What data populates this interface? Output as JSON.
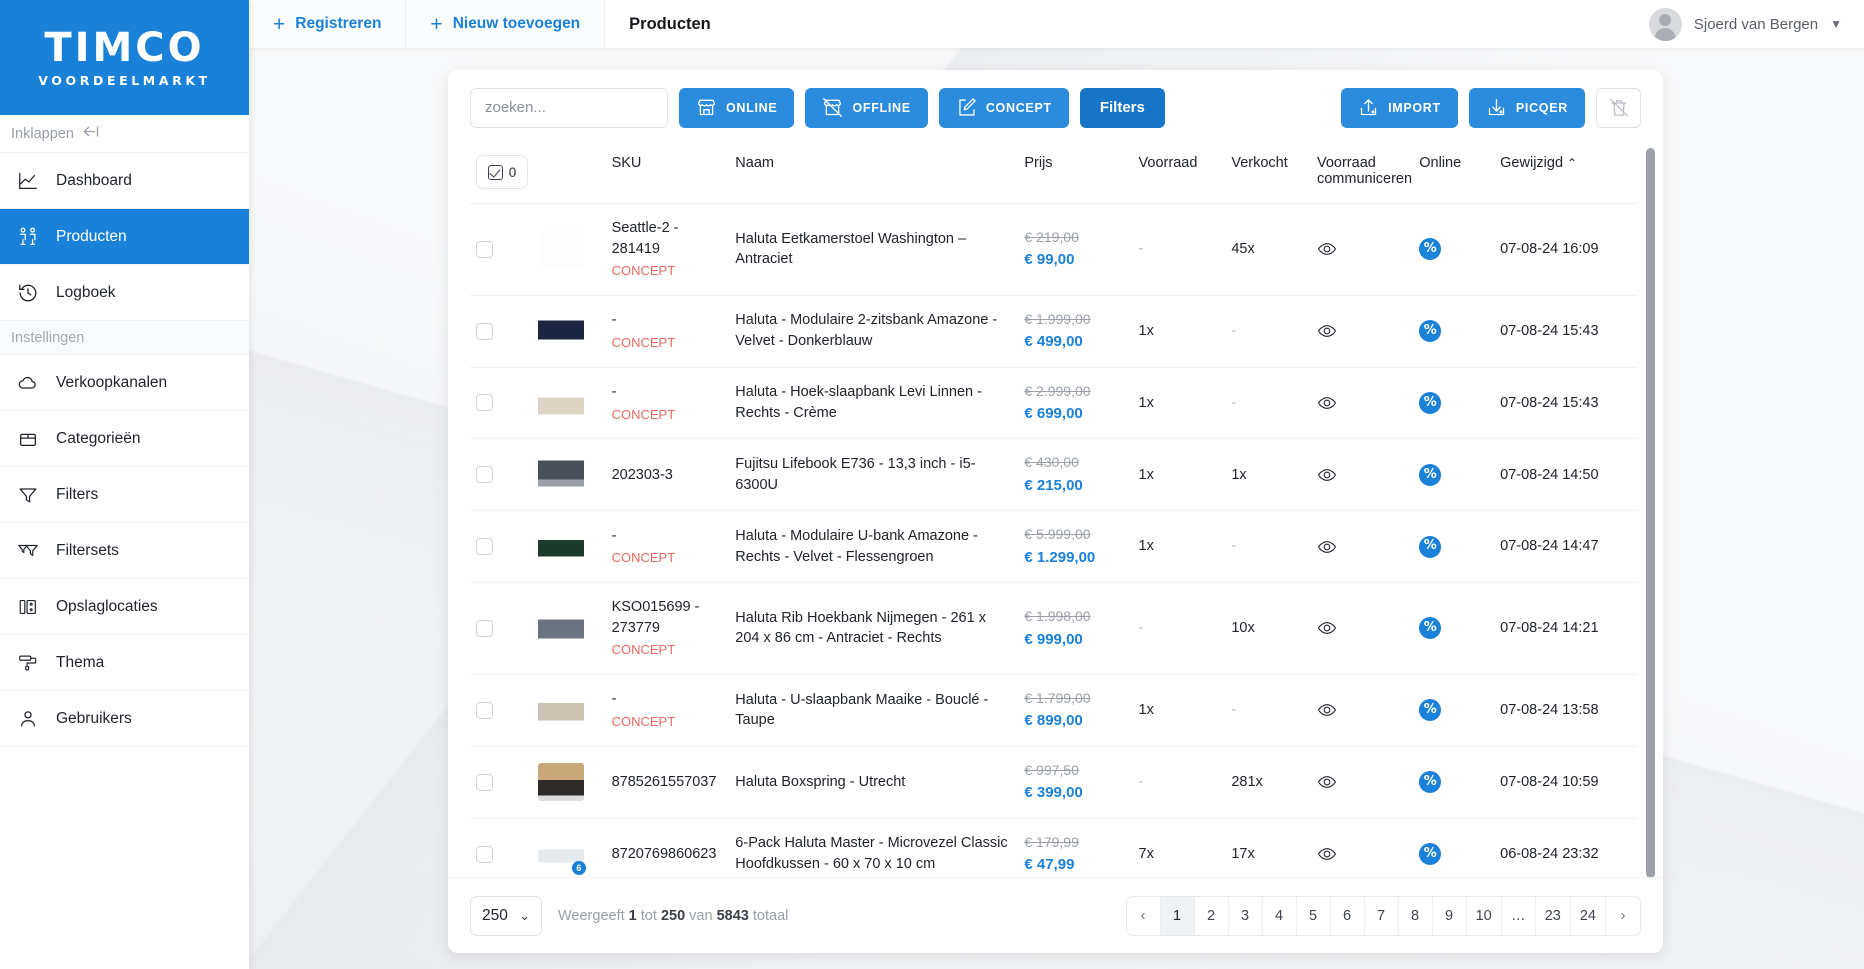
{
  "brand": {
    "name": "TIMCO",
    "tagline": "VOORDEELMARKT",
    "accent": "#1a81d8"
  },
  "sidebar": {
    "collapse_label": "Inklappen",
    "collapse_icon": "collapse-arrow-icon",
    "section_label": "Instellingen",
    "items": [
      {
        "label": "Dashboard",
        "icon": "chart-line-icon",
        "active": false
      },
      {
        "label": "Producten",
        "icon": "products-icon",
        "active": true
      },
      {
        "label": "Logboek",
        "icon": "history-clock-icon",
        "active": false
      }
    ],
    "settings_items": [
      {
        "label": "Verkoopkanalen",
        "icon": "cloud-icon"
      },
      {
        "label": "Categorieën",
        "icon": "box-icon"
      },
      {
        "label": "Filters",
        "icon": "funnel-icon"
      },
      {
        "label": "Filtersets",
        "icon": "double-funnel-icon"
      },
      {
        "label": "Opslaglocaties",
        "icon": "warehouse-icon"
      },
      {
        "label": "Thema",
        "icon": "paint-roller-icon"
      },
      {
        "label": "Gebruikers",
        "icon": "user-icon"
      }
    ]
  },
  "topbar": {
    "register_label": "Registreren",
    "new_label": "Nieuw toevoegen",
    "page_title": "Producten",
    "user_name": "Sjoerd van Bergen"
  },
  "toolbar": {
    "search_placeholder": "zoeken...",
    "search_value": "",
    "online_label": "ONLINE",
    "offline_label": "OFFLINE",
    "concept_label": "CONCEPT",
    "filters_label": "Filters",
    "import_label": "IMPORT",
    "picqer_label": "PICQER",
    "delete_icon": "trash-disabled-icon"
  },
  "table": {
    "selected_count": "0",
    "headers": {
      "sku": "SKU",
      "naam": "Naam",
      "prijs": "Prijs",
      "voorraad": "Voorraad",
      "verkocht": "Verkocht",
      "voorraad_communiceren": "Voorraad communiceren",
      "online": "Online",
      "gewijzigd": "Gewijzigd",
      "sort_caret": "⌃"
    },
    "rows": [
      {
        "sku": "Seattle-2 - 281419",
        "concept": "CONCEPT",
        "naam": "Haluta Eetkamerstoel Washington – Antraciet",
        "prijs_oud": "€ 219,00",
        "prijs_nieuw": "€ 99,00",
        "voorraad": "-",
        "verkocht": "45x",
        "gewijzigd": "07-08-24 16:09",
        "thumb": "chair",
        "badge": ""
      },
      {
        "sku": "-",
        "concept": "CONCEPT",
        "naam": "Haluta - Modulaire 2-zitsbank Amazone - Velvet - Donkerblauw",
        "prijs_oud": "€ 1.999,00",
        "prijs_nieuw": "€ 499,00",
        "voorraad": "1x",
        "verkocht": "-",
        "gewijzigd": "07-08-24 15:43",
        "thumb": "sofa-navy",
        "badge": ""
      },
      {
        "sku": "-",
        "concept": "CONCEPT",
        "naam": "Haluta - Hoek-slaapbank Levi Linnen - Rechts - Crème",
        "prijs_oud": "€ 2.999,00",
        "prijs_nieuw": "€ 699,00",
        "voorraad": "1x",
        "verkocht": "-",
        "gewijzigd": "07-08-24 15:43",
        "thumb": "sofa-cream",
        "badge": ""
      },
      {
        "sku": "202303-3",
        "concept": "",
        "naam": "Fujitsu Lifebook E736 - 13,3 inch - i5-6300U",
        "prijs_oud": "€ 430,00",
        "prijs_nieuw": "€ 215,00",
        "voorraad": "1x",
        "verkocht": "1x",
        "gewijzigd": "07-08-24 14:50",
        "thumb": "laptop",
        "badge": ""
      },
      {
        "sku": "-",
        "concept": "CONCEPT",
        "naam": "Haluta - Modulaire U-bank Amazone - Rechts - Velvet - Flessengroen",
        "prijs_oud": "€ 5.999,00",
        "prijs_nieuw": "€ 1.299,00",
        "voorraad": "1x",
        "verkocht": "-",
        "gewijzigd": "07-08-24 14:47",
        "thumb": "sofa-green",
        "badge": ""
      },
      {
        "sku": "KSO015699 - 273779",
        "concept": "CONCEPT",
        "naam": "Haluta Rib Hoekbank Nijmegen - 261 x 204 x 86 cm - Antraciet - Rechts",
        "prijs_oud": "€ 1.998,00",
        "prijs_nieuw": "€ 999,00",
        "voorraad": "-",
        "verkocht": "10x",
        "gewijzigd": "07-08-24 14:21",
        "thumb": "sofa-grey",
        "badge": ""
      },
      {
        "sku": "-",
        "concept": "CONCEPT",
        "naam": "Haluta - U-slaapbank Maaike - Bouclé - Taupe",
        "prijs_oud": "€ 1.799,00",
        "prijs_nieuw": "€ 899,00",
        "voorraad": "1x",
        "verkocht": "-",
        "gewijzigd": "07-08-24 13:58",
        "thumb": "sofa-taupe",
        "badge": ""
      },
      {
        "sku": "8785261557037",
        "concept": "",
        "naam": "Haluta Boxspring - Utrecht",
        "prijs_oud": "€ 997,50",
        "prijs_nieuw": "€ 399,00",
        "voorraad": "-",
        "verkocht": "281x",
        "gewijzigd": "07-08-24 10:59",
        "thumb": "bed",
        "badge": ""
      },
      {
        "sku": "8720769860623",
        "concept": "",
        "naam": "6-Pack Haluta Master - Microvezel Classic Hoofdkussen - 60 x 70 x 10 cm",
        "prijs_oud": "€ 179,99",
        "prijs_nieuw": "€ 47,99",
        "voorraad": "7x",
        "verkocht": "17x",
        "gewijzigd": "06-08-24 23:32",
        "thumb": "pillows",
        "badge": "6"
      }
    ]
  },
  "footer": {
    "per_page": "250",
    "showing_prefix": "Weergeeft",
    "showing_from": "1",
    "showing_mid": "tot",
    "showing_to": "250",
    "showing_van": "van",
    "showing_total": "5843",
    "showing_suffix": "totaal",
    "pages": [
      "1",
      "2",
      "3",
      "4",
      "5",
      "6",
      "7",
      "8",
      "9",
      "10",
      "…",
      "23",
      "24"
    ],
    "active_page": "1",
    "prev_icon": "chevron-left-icon",
    "next_icon": "chevron-right-icon"
  }
}
